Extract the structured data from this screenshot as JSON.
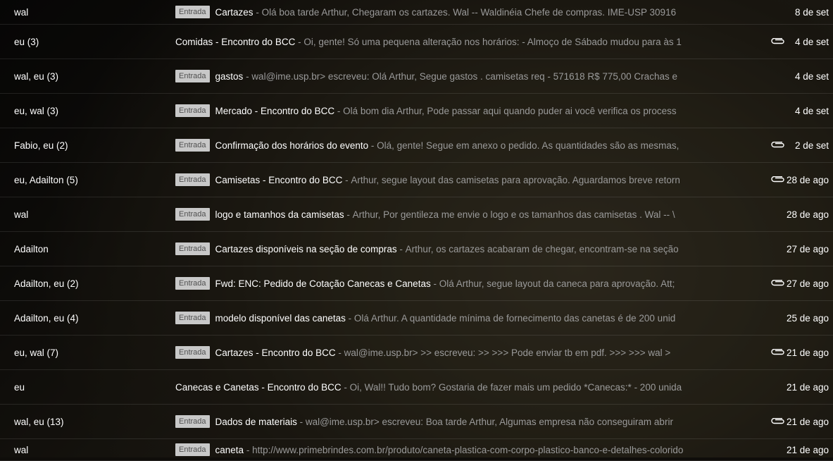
{
  "rows": [
    {
      "sender": "wal",
      "badge": "Entrada",
      "subject": "Cartazes",
      "snippet": "Olá boa tarde Arthur, Chegaram os cartazes. Wal -- Waldinéia Chefe de compras. IME-USP 30916",
      "attachment": false,
      "date": "8 de set"
    },
    {
      "sender": "eu (3)",
      "badge": "",
      "subject": "Comidas - Encontro do BCC",
      "snippet": "Oi, gente! Só uma pequena alteração nos horários: - Almoço de Sábado mudou para às 1",
      "attachment": true,
      "date": "4 de set"
    },
    {
      "sender": "wal, eu (3)",
      "badge": "Entrada",
      "subject": "gastos",
      "snippet": "wal@ime.usp.br> escreveu: Olá Arthur, Segue gastos . camisetas req - 571618 R$ 775,00 Crachas e",
      "attachment": false,
      "date": "4 de set"
    },
    {
      "sender": "eu, wal (3)",
      "badge": "Entrada",
      "subject": "Mercado - Encontro do BCC",
      "snippet": "Olá bom dia Arthur, Pode passar aqui quando puder ai você verifica os process",
      "attachment": false,
      "date": "4 de set"
    },
    {
      "sender": "Fabio, eu (2)",
      "badge": "Entrada",
      "subject": "Confirmação dos horários do evento",
      "snippet": "Olá, gente! Segue em anexo o pedido. As quantidades são as mesmas,",
      "attachment": true,
      "date": "2 de set"
    },
    {
      "sender": "eu, Adailton (5)",
      "badge": "Entrada",
      "subject": "Camisetas - Encontro do BCC",
      "snippet": "Arthur, segue layout das camisetas para aprovação. Aguardamos breve retorn",
      "attachment": true,
      "date": "28 de ago"
    },
    {
      "sender": "wal",
      "badge": "Entrada",
      "subject": "logo e tamanhos da camisetas",
      "snippet": "Arthur, Por gentileza me envie o logo e os tamanhos das camisetas . Wal -- \\",
      "attachment": false,
      "date": "28 de ago"
    },
    {
      "sender": "Adailton",
      "badge": "Entrada",
      "subject": "Cartazes disponíveis na seção de compras",
      "snippet": "Arthur, os cartazes acabaram de chegar, encontram-se na seção",
      "attachment": false,
      "date": "27 de ago"
    },
    {
      "sender": "Adailton, eu (2)",
      "badge": "Entrada",
      "subject": "Fwd: ENC: Pedido de Cotação Canecas e Canetas",
      "snippet": "Olá Arthur, segue layout da caneca para aprovação. Att;",
      "attachment": true,
      "date": "27 de ago"
    },
    {
      "sender": "Adailton, eu (4)",
      "badge": "Entrada",
      "subject": "modelo disponível das canetas",
      "snippet": "Olá Arthur. A quantidade mínima de fornecimento das canetas é de 200 unid",
      "attachment": false,
      "date": "25 de ago"
    },
    {
      "sender": "eu, wal (7)",
      "badge": "Entrada",
      "subject": "Cartazes - Encontro do BCC",
      "snippet": "wal@ime.usp.br> >> escreveu: >> >>> Pode enviar tb em pdf. >>> >>> wal >",
      "attachment": true,
      "date": "21 de ago"
    },
    {
      "sender": "eu",
      "badge": "",
      "subject": "Canecas e Canetas - Encontro do BCC",
      "snippet": "Oi, Wal!! Tudo bom? Gostaria de fazer mais um pedido *Canecas:* - 200 unida",
      "attachment": false,
      "date": "21 de ago"
    },
    {
      "sender": "wal, eu (13)",
      "badge": "Entrada",
      "subject": "Dados de materiais",
      "snippet": "wal@ime.usp.br> escreveu: Boa tarde Arthur, Algumas empresa não conseguiram abrir",
      "attachment": true,
      "date": "21 de ago"
    },
    {
      "sender": "wal",
      "badge": "Entrada",
      "subject": "caneta",
      "snippet": "http://www.primebrindes.com.br/produto/caneta-plastica-com-corpo-plastico-banco-e-detalhes-colorido",
      "attachment": false,
      "date": "21 de ago"
    }
  ],
  "separator": " - ",
  "icons": {
    "attachment": "paperclip-icon"
  }
}
